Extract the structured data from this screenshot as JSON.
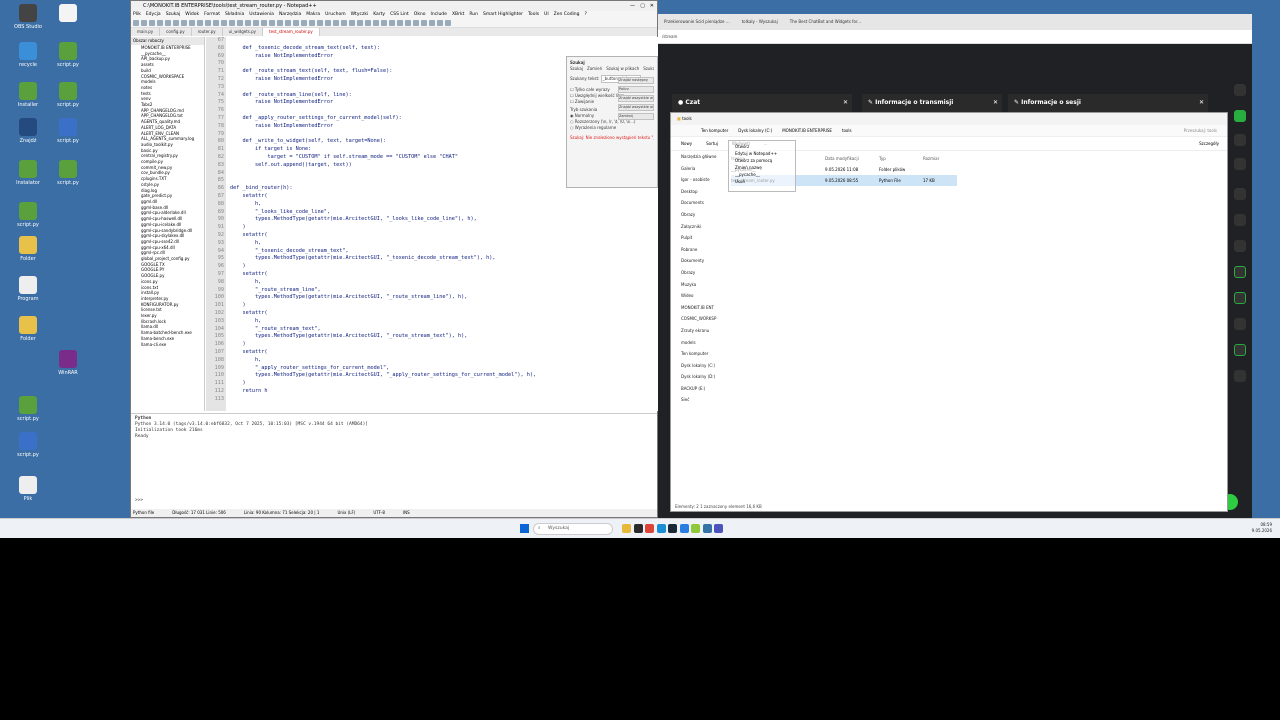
{
  "desktop": {
    "icons": [
      {
        "label": "OBS Studio",
        "color": "#444"
      },
      {
        "label": "",
        "color": "#f4f4f4"
      },
      {
        "label": "recycle",
        "color": "#3b8fd9"
      },
      {
        "label": "script.py",
        "color": "#5aa03c"
      },
      {
        "label": "Installer",
        "color": "#5aa03c"
      },
      {
        "label": "script.py",
        "color": "#5aa03c"
      },
      {
        "label": "Znajdź",
        "color": "#244a80"
      },
      {
        "label": "script.py",
        "color": "#3a70c8"
      },
      {
        "label": "Instalator",
        "color": "#5aa03c"
      },
      {
        "label": "script.py",
        "color": "#5aa03c"
      },
      {
        "label": "script.py",
        "color": "#5aa03c"
      },
      {
        "label": "Folder",
        "color": "#e8c14b"
      },
      {
        "label": "Program",
        "color": "#eee"
      },
      {
        "label": "Folder",
        "color": "#e8c14b"
      },
      {
        "label": "WinRAR",
        "color": "#7a2c8a"
      },
      {
        "label": "script.py",
        "color": "#5aa03c"
      },
      {
        "label": "script.py",
        "color": "#3a70c8"
      },
      {
        "label": "Plik",
        "color": "#eee"
      }
    ]
  },
  "npp": {
    "title": "C:\\MONOKIT.IB ENTERPRISE\\tools\\test_stream_router.py - Notepad++",
    "menu": [
      "Plik",
      "Edycja",
      "Szukaj",
      "Widok",
      "Format",
      "Składnia",
      "Ustawienia",
      "Narzędzia",
      "Makra",
      "Uruchom",
      "Wtyczki",
      "Karty",
      "CSS Lint",
      "Okno",
      "Include",
      "XBrkt",
      "Run",
      "Smart Highlighter",
      "Tools",
      "UI",
      "Zen Coding",
      "?"
    ],
    "tabs": [
      "main.py",
      "config.py",
      "router.py",
      "ui_widgets.py",
      "test_stream_router.py"
    ],
    "active_tab": 4,
    "folder_header": "Obszar roboczy",
    "files": [
      "MONOKIT.IB ENTERPRISE",
      "__pycache__",
      "API_backup.py",
      "assets",
      "build",
      "COSMIC_WORKSPACE",
      "models",
      "notes",
      "tests",
      "venv",
      "Tabs2",
      "APP_CHANGELOG.md",
      "APP_CHANGELOG.txt",
      "AGENTS_quality.md",
      "ALERT_LOG_DATA",
      "ALERT_ENV_CLEAN",
      "ALL_AGENTS_summary.log",
      "audio_toolkit.py",
      "basic.py",
      "central_registry.py",
      "compile.py",
      "commit_new.py",
      "cov_bundle.py",
      "cplugins.TXT",
      "cstyle.py",
      "diag.log",
      "gate_predict.py",
      "ggml.dll",
      "ggml-base.dll",
      "ggml-cpu-alderlake.dll",
      "ggml-cpu-haswell.dll",
      "ggml-cpu-icelake.dll",
      "ggml-cpu-sandybridge.dll",
      "ggml-cpu-skylakex.dll",
      "ggml-cpu-sse42.dll",
      "ggml-cpu-x64.dll",
      "ggml-rpc.dll",
      "global_project_config.py",
      "GOOGLE.TX",
      "GOOGLE.PY",
      "GOOGLE.py",
      "icons.py",
      "icons.txt",
      "install.py",
      "interpreter.py",
      "KONFIGURATOR.py",
      "license.txt",
      "lexer.py",
      "libcrash.lock",
      "llama.dll",
      "llama-batched-bench.exe",
      "llama-bench.exe",
      "llama-cli.exe"
    ],
    "code": [
      {
        "n": "67",
        "t": ""
      },
      {
        "n": "68",
        "t": "    def _toxenic_decode_stream_text(self, text):"
      },
      {
        "n": "69",
        "t": "        raise NotImplementedError"
      },
      {
        "n": "70",
        "t": ""
      },
      {
        "n": "71",
        "t": "    def _route_stream_text(self, text, flush=False):"
      },
      {
        "n": "72",
        "t": "        raise NotImplementedError"
      },
      {
        "n": "73",
        "t": ""
      },
      {
        "n": "74",
        "t": "    def _route_stream_line(self, line):"
      },
      {
        "n": "75",
        "t": "        raise NotImplementedError"
      },
      {
        "n": "76",
        "t": ""
      },
      {
        "n": "77",
        "t": "    def _apply_router_settings_for_current_model(self):"
      },
      {
        "n": "78",
        "t": "        raise NotImplementedError"
      },
      {
        "n": "79",
        "t": ""
      },
      {
        "n": "80",
        "t": "    def _write_to_widget(self, text, target=None):"
      },
      {
        "n": "81",
        "t": "        if target is None:"
      },
      {
        "n": "82",
        "t": "            target = \"CUSTOM\" if self.stream_mode == \"CUSTOM\" else \"CHAT\""
      },
      {
        "n": "83",
        "t": "        self.out.append((target, text))"
      },
      {
        "n": "84",
        "t": ""
      },
      {
        "n": "85",
        "t": ""
      },
      {
        "n": "86",
        "t": "def _bind_router(h):"
      },
      {
        "n": "87",
        "t": "    setattr("
      },
      {
        "n": "88",
        "t": "        h,"
      },
      {
        "n": "89",
        "t": "        \"_looks_like_code_line\","
      },
      {
        "n": "90",
        "t": "        types.MethodType(getattr(mie.ArcitectGUI, \"_looks_like_code_line\"), h),"
      },
      {
        "n": "91",
        "t": "    )"
      },
      {
        "n": "92",
        "t": "    setattr("
      },
      {
        "n": "93",
        "t": "        h,"
      },
      {
        "n": "94",
        "t": "        \"_toxenic_decode_stream_text\","
      },
      {
        "n": "95",
        "t": "        types.MethodType(getattr(mie.ArcitectGUI, \"_toxenic_decode_stream_text\"), h),"
      },
      {
        "n": "96",
        "t": "    )"
      },
      {
        "n": "97",
        "t": "    setattr("
      },
      {
        "n": "98",
        "t": "        h,"
      },
      {
        "n": "99",
        "t": "        \"_route_stream_line\","
      },
      {
        "n": "100",
        "t": "        types.MethodType(getattr(mie.ArcitectGUI, \"_route_stream_line\"), h),"
      },
      {
        "n": "101",
        "t": "    )"
      },
      {
        "n": "102",
        "t": "    setattr("
      },
      {
        "n": "103",
        "t": "        h,"
      },
      {
        "n": "104",
        "t": "        \"_route_stream_text\","
      },
      {
        "n": "105",
        "t": "        types.MethodType(getattr(mie.ArcitectGUI, \"_route_stream_text\"), h),"
      },
      {
        "n": "106",
        "t": "    )"
      },
      {
        "n": "107",
        "t": "    setattr("
      },
      {
        "n": "108",
        "t": "        h,"
      },
      {
        "n": "109",
        "t": "        \"_apply_router_settings_for_current_model\","
      },
      {
        "n": "110",
        "t": "        types.MethodType(getattr(mie.ArcitectGUI, \"_apply_router_settings_for_current_model\"), h),"
      },
      {
        "n": "111",
        "t": "    )"
      },
      {
        "n": "112",
        "t": "    return h"
      },
      {
        "n": "113",
        "t": ""
      }
    ],
    "console_title": "Python",
    "console_lines": [
      "Python 3.14.0 (tags/v3.14.0:ebf6832, Oct  7 2025, 10:15:03) [MSC v.1944 64 bit (AMD64)]",
      "Initialization took 216ms",
      "Ready"
    ],
    "console_prompt": ">>>",
    "status": {
      "lang": "Python file",
      "length": "Długość: 17 031  Linie: 506",
      "pos": "Linia: 90   Kolumna: 71   Selekcja: 20 | 1",
      "eol": "Unix (LF)",
      "enc": "UTF-8",
      "mode": "INS"
    }
  },
  "find_dialog": {
    "title": "Szukaj",
    "tabs": [
      "Szukaj",
      "Zamień",
      "Szukaj w plikach",
      "Szukaj w projektach",
      "Oznacz"
    ],
    "find_label": "Szukany tekst:",
    "find_value": "_button_pick",
    "options": [
      "Tylko całe wyrazy",
      "Uwzględnij wielkość liter",
      "Zawijanie"
    ],
    "mode_label": "Tryb szukania",
    "modes": [
      "Normalny",
      "Rozszerzony (\\n, \\r, \\t, \\0, \\x...)",
      "Wyrażenia regularne"
    ],
    "buttons": [
      "Znajdź następny",
      "Policz",
      "Znajdź wszystkie w bieżącym dokumencie",
      "Znajdź wszystkie we wszystkich otwartych dokumentach",
      "Zamknij"
    ],
    "message": "Szukaj: Nie znaleziono wystąpień tekstu \"_button_pick\"."
  },
  "browser": {
    "tabs": [
      "Przekierowanie Scid pieniądze ...",
      "tolkaly - Wyszukaj",
      "The Best ChatBot and Widgets for...",
      ""
    ],
    "url": "/stream",
    "panels": [
      {
        "title": "Czat"
      },
      {
        "title": "Informacje o transmisji"
      },
      {
        "title": "Informacje o sesji"
      }
    ]
  },
  "explorer": {
    "title": "tools",
    "breadcrumb": [
      "Ten komputer",
      "Dysk lokalny (C:)",
      "MONOKIT.IB ENTERPRISE",
      "tools"
    ],
    "search_placeholder": "Przeszukaj: tools",
    "commands": [
      "Nowy",
      "Sortuj",
      "Wyświetl",
      "..."
    ],
    "details_label": "Szczegóły",
    "nav": [
      "Narzędzia główne",
      "Galeria",
      "Igor - osobiste",
      "Desktop",
      "Documents",
      "Obrazy",
      "Załączniki",
      "Pulpit",
      "Pobrane",
      "Dokumenty",
      "Obrazy",
      "Muzyka",
      "Wideo",
      "MONOKIT.IB ENT",
      "COSMIC_WORKSP",
      "Zrzuty ekranu",
      "models",
      "Ten komputer",
      "Dysk lokalny (C:)",
      "Dysk lokalny (D:)",
      "BACKUP (E:)",
      "Sieć"
    ],
    "columns": [
      "Nazwa",
      "Data modyfikacji",
      "Typ",
      "Rozmiar"
    ],
    "rows": [
      {
        "name": "__pycache__",
        "date": "9.05.2026 11:08",
        "type": "Folder plików",
        "size": ""
      },
      {
        "name": "test_stream_router.py",
        "date": "9.05.2026 08:55",
        "type": "Python File",
        "size": "17 KB"
      }
    ],
    "status": "Elementy: 2    1 zaznaczony element  16,6 KB"
  },
  "overlay_menu": {
    "items": [
      "Otwórz",
      "Edytuj w Notepad++",
      "Otwórz za pomocą",
      "Zmień nazwę",
      "__pycache__",
      "Usuń"
    ]
  },
  "taskbar": {
    "search": "Wyszukaj",
    "time": "08:59",
    "date": "9.05.2026",
    "apps": [
      {
        "name": "explorer",
        "color": "#e8b83a"
      },
      {
        "name": "taskview",
        "color": "#2b2b2b"
      },
      {
        "name": "chrome",
        "color": "#db4437"
      },
      {
        "name": "edge",
        "color": "#1a8fd6"
      },
      {
        "name": "steam",
        "color": "#1b2838"
      },
      {
        "name": "store",
        "color": "#2a7de1"
      },
      {
        "name": "notepadpp",
        "color": "#8fc93a"
      },
      {
        "name": "python",
        "color": "#3572a5"
      },
      {
        "name": "teams",
        "color": "#4b53bc"
      }
    ]
  }
}
